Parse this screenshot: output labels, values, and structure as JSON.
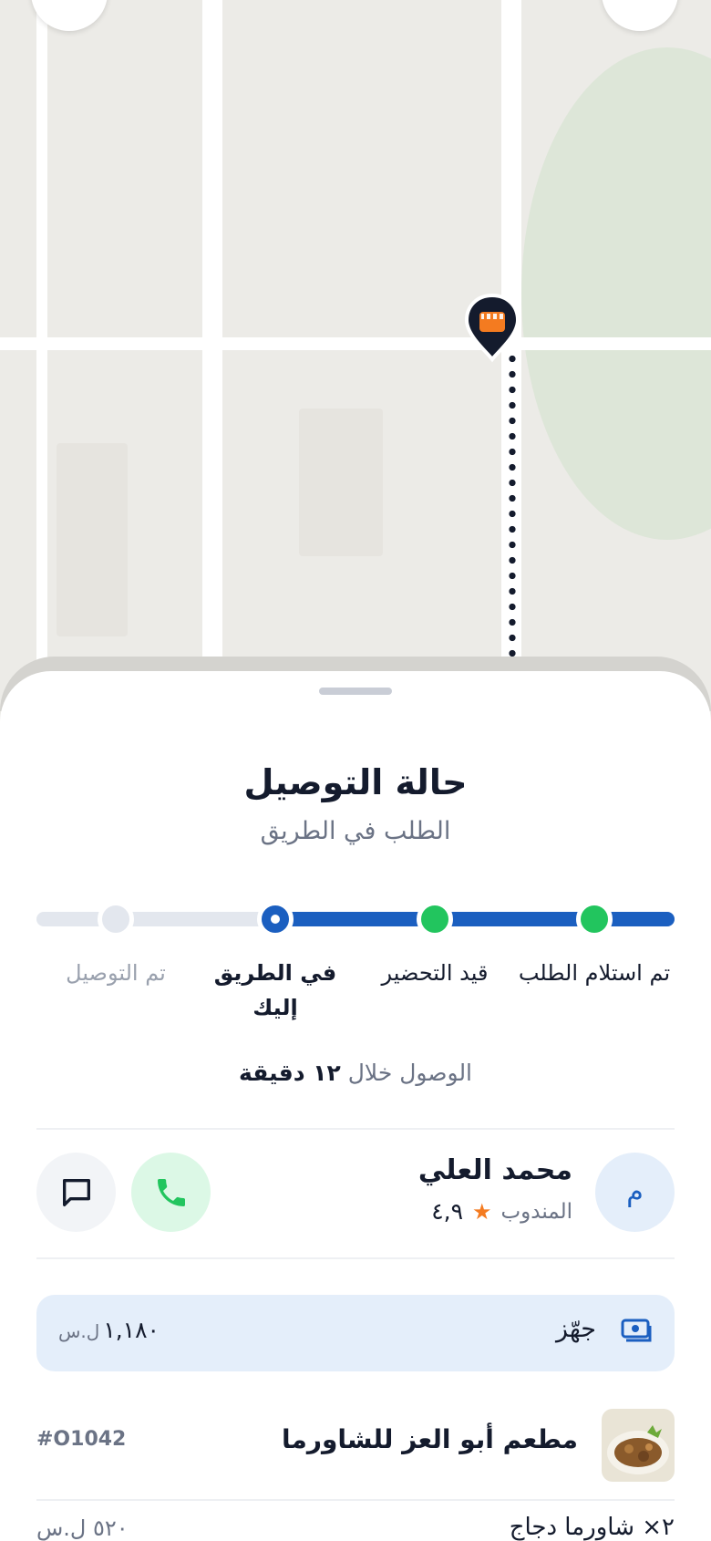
{
  "map": {
    "store_pin_icon": "store-icon",
    "colors": {
      "map_bg": "#ECEBE7",
      "park": "#DDE6D8",
      "route": "#141B2D",
      "pin_accent": "#F47B20"
    }
  },
  "delivery": {
    "title": "حالة التوصيل",
    "subtitle": "الطلب في الطريق",
    "progress": {
      "current_step_index": 2,
      "steps": [
        {
          "label": "تم استلام الطلب",
          "state": "done"
        },
        {
          "label": "قيد التحضير",
          "state": "done"
        },
        {
          "label": "في الطريق إليك",
          "state": "current"
        },
        {
          "label": "تم التوصيل",
          "state": "todo"
        }
      ]
    },
    "eta_prefix": "الوصول خلال",
    "eta_value": "١٢ دقيقة"
  },
  "courier": {
    "avatar_initial": "م",
    "name": "محمد العلي",
    "role": "المندوب",
    "rating": "٤,٩",
    "call_icon": "phone-icon",
    "chat_icon": "chat-icon"
  },
  "payment": {
    "icon": "cash-icon",
    "label": "جهّز",
    "amount": "١,١٨٠",
    "currency": "ل.س"
  },
  "order": {
    "restaurant_name": "مطعم أبو العز للشاورما",
    "order_id": "#O1042",
    "items": [
      {
        "name": "٢× شاورما دجاج",
        "price": "٥٢٠",
        "currency": "ل.س"
      }
    ]
  },
  "colors": {
    "primary": "#1B5FC0",
    "success": "#22C55E",
    "accent": "#F47B20",
    "text": "#141B2D",
    "muted": "#6B7385"
  }
}
